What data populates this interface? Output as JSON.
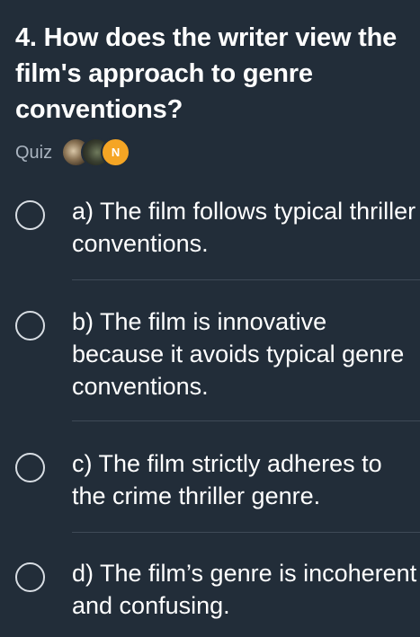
{
  "question": {
    "text": "4. How does the writer view the film's approach to genre conventions?"
  },
  "quiz": {
    "label": "Quiz",
    "avatars": [
      {
        "kind": "photo",
        "icon": "cat-avatar-icon"
      },
      {
        "kind": "photo",
        "icon": "dark-photo-avatar-icon"
      },
      {
        "kind": "initial",
        "initial": "N",
        "color": "#f5a524"
      }
    ]
  },
  "options": [
    {
      "text": "a) The film follows typical thriller conventions."
    },
    {
      "text": "b) The film is innovative because it avoids typical genre conventions."
    },
    {
      "text": "c) The film strictly adheres to the crime thriller genre."
    },
    {
      "text": "d) The film’s genre is incoherent and confusing."
    }
  ],
  "colors": {
    "background": "#222d39",
    "text": "#ffffff",
    "muted": "#aab4c0",
    "divider": "#3f4a57",
    "radio_border": "#d8dde3"
  }
}
